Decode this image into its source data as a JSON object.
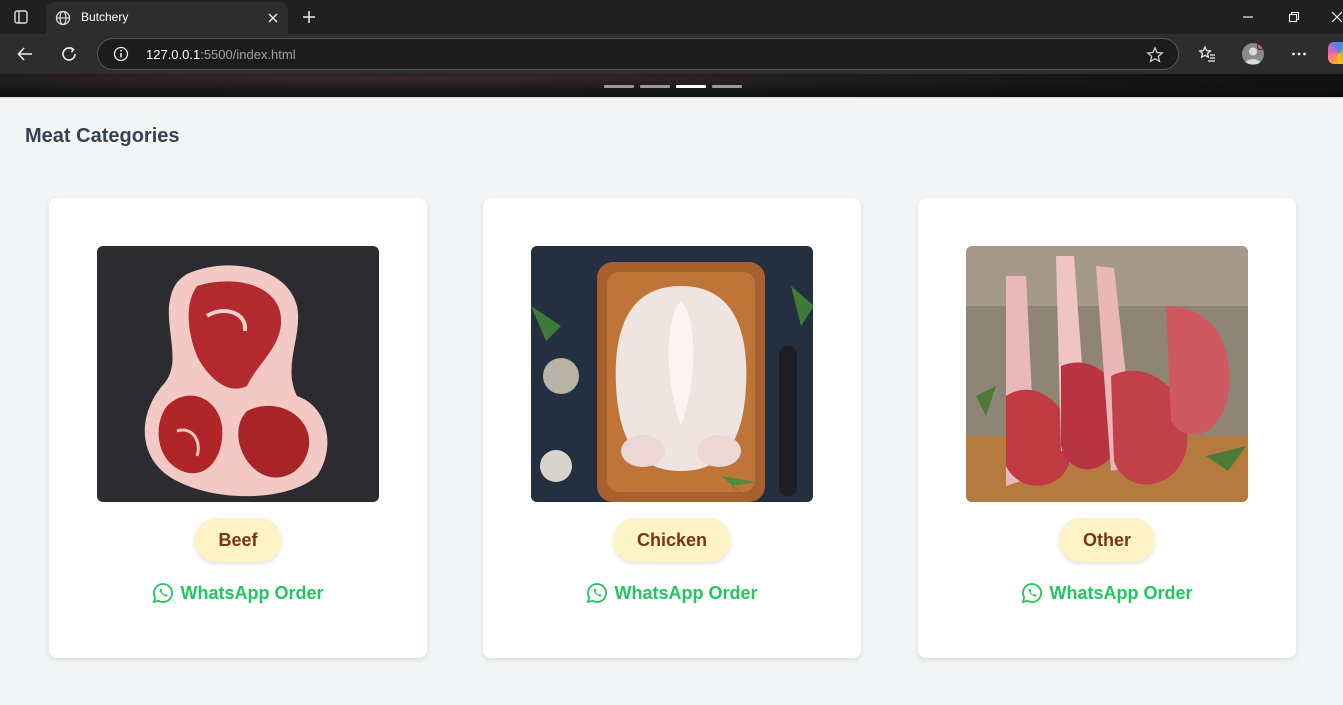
{
  "browser": {
    "tab_title": "Butchery",
    "url_host": "127.0.0.1",
    "url_rest": ":5500/index.html"
  },
  "hero": {
    "slides": 4,
    "active_slide": 3
  },
  "main": {
    "section_title": "Meat Categories",
    "categories": [
      {
        "name": "Beef",
        "order_label": "WhatsApp Order",
        "image": "beef-steak-image"
      },
      {
        "name": "Chicken",
        "order_label": "WhatsApp Order",
        "image": "whole-chicken-image"
      },
      {
        "name": "Other",
        "order_label": "WhatsApp Order",
        "image": "lamb-ribs-image"
      }
    ]
  },
  "colors": {
    "pill_bg": "#fef3c7",
    "pill_text": "#78350f",
    "whatsapp_green": "#22c55e",
    "heading": "#374151"
  }
}
